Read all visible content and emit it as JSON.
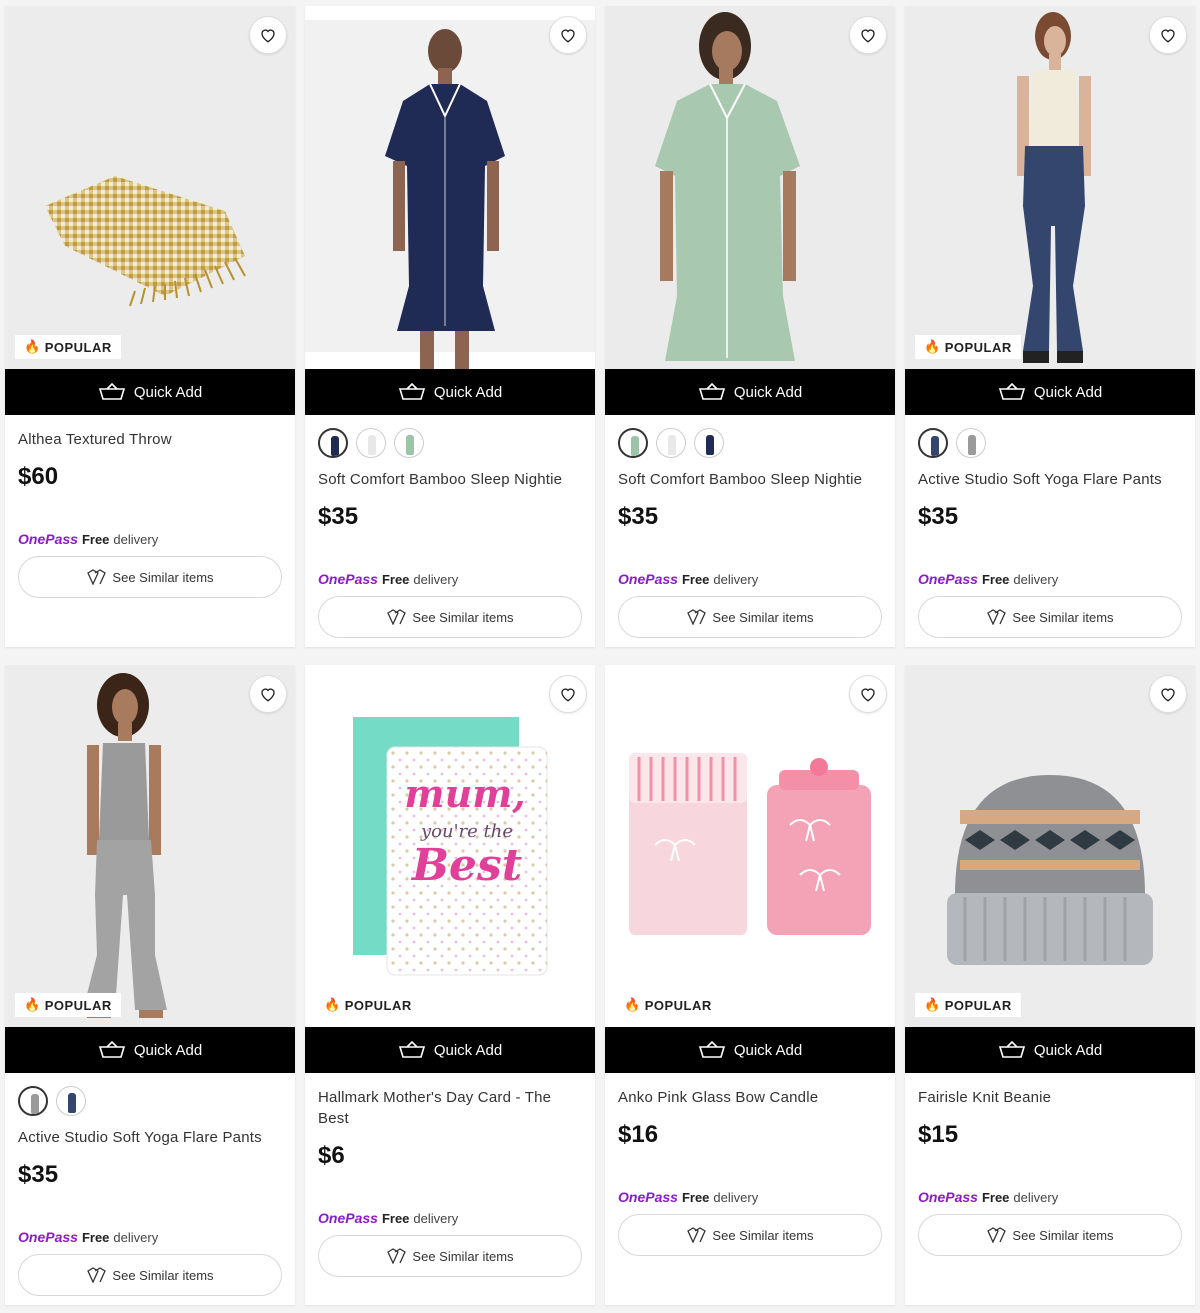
{
  "ui": {
    "quick_add_label": "Quick Add",
    "popular_label": "POPULAR",
    "onepass_brand": "OnePass",
    "free_label": "Free",
    "delivery_label": "delivery",
    "see_similar_label": "See Similar items",
    "brand_color": "#8a1cc8"
  },
  "products": [
    {
      "title": "Althea Textured Throw",
      "price": "$60",
      "popular": true,
      "swatch_colors": []
    },
    {
      "title": "Soft Comfort Bamboo Sleep Nightie",
      "price": "$35",
      "popular": false,
      "swatch_colors": [
        "#1f2a55",
        "#e8e8e8",
        "#9cc4a8"
      ]
    },
    {
      "title": "Soft Comfort Bamboo Sleep Nightie",
      "price": "$35",
      "popular": false,
      "swatch_colors": [
        "#9cc4a8",
        "#e8e8e8",
        "#1f2a55"
      ]
    },
    {
      "title": "Active Studio Soft Yoga Flare Pants",
      "price": "$35",
      "popular": true,
      "swatch_colors": [
        "#34466e",
        "#9a9a9a"
      ]
    },
    {
      "title": "Active Studio Soft Yoga Flare Pants",
      "price": "$35",
      "popular": true,
      "swatch_colors": [
        "#9a9a9a",
        "#34466e"
      ]
    },
    {
      "title": "Hallmark Mother's Day Card - The Best",
      "price": "$6",
      "popular": true,
      "swatch_colors": []
    },
    {
      "title": "Anko Pink Glass Bow Candle",
      "price": "$16",
      "popular": true,
      "swatch_colors": []
    },
    {
      "title": "Fairisle Knit Beanie",
      "price": "$15",
      "popular": true,
      "swatch_colors": []
    }
  ],
  "card_texts": {
    "mum": "mum,",
    "youre_the": "you're the",
    "best": "Best"
  }
}
